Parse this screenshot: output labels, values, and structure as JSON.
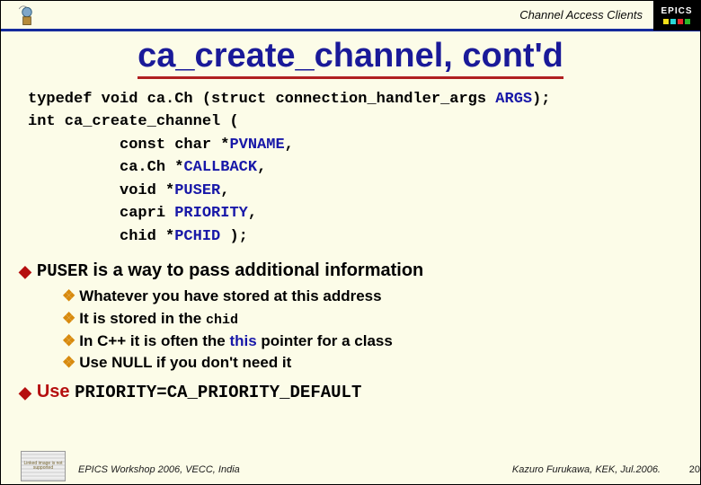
{
  "header": {
    "topic": "Channel Access Clients",
    "epics_label": "EPICS"
  },
  "title": "ca_create_channel, cont'd",
  "code": {
    "l1a": "typedef void ca.Ch (struct connection_handler_args ",
    "l1b": "ARGS",
    "l1c": ");",
    "l2": "int ca_create_channel (",
    "l3a": "          const char *",
    "l3b": "PVNAME",
    "l3c": ",",
    "l4a": "          ca.Ch *",
    "l4b": "CALLBACK",
    "l4c": ",",
    "l5a": "          void *",
    "l5b": "PUSER",
    "l5c": ",",
    "l6a": "          capri ",
    "l6b": "PRIORITY",
    "l6c": ",",
    "l7a": "          chid *",
    "l7b": "PCHID",
    "l7c": " );"
  },
  "b1a_mono": "PUSER",
  "b1a_rest": " is a way to pass additional information",
  "sub": {
    "s1": "Whatever you have stored at this address",
    "s2a": "It is stored in the ",
    "s2b": "chid",
    "s3a": "In C++ it is often the ",
    "s3b": "this",
    "s3c": " pointer for a class",
    "s4": "Use NULL if you don't need it"
  },
  "b1b_pre": "Use ",
  "b1b_mono": "PRIORITY=CA_PRIORITY_DEFAULT",
  "footer": {
    "thumb_text": "Linked image is not supported",
    "left": "EPICS Workshop 2006, VECC, India",
    "right": "Kazuro Furukawa, KEK, Jul.2006.",
    "page": "20"
  }
}
